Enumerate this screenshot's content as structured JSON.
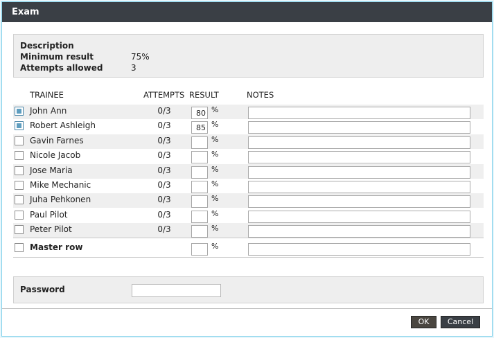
{
  "window": {
    "title": "Exam"
  },
  "info": {
    "description_label": "Description",
    "description_value": "",
    "min_result_label": "Minimum result",
    "min_result_value": "75%",
    "attempts_label": "Attempts allowed",
    "attempts_value": "3"
  },
  "table": {
    "headers": {
      "trainee": "TRAINEE",
      "attempts": "ATTEMPTS",
      "result": "RESULT",
      "notes": "NOTES"
    },
    "percent_sign": "%",
    "rows": [
      {
        "name": "John Ann",
        "attempts": "0/3",
        "result": "80",
        "checked": true
      },
      {
        "name": "Robert Ashleigh",
        "attempts": "0/3",
        "result": "85",
        "checked": true
      },
      {
        "name": "Gavin Farnes",
        "attempts": "0/3",
        "result": "",
        "checked": false
      },
      {
        "name": "Nicole Jacob",
        "attempts": "0/3",
        "result": "",
        "checked": false
      },
      {
        "name": "Jose Maria",
        "attempts": "0/3",
        "result": "",
        "checked": false
      },
      {
        "name": "Mike Mechanic",
        "attempts": "0/3",
        "result": "",
        "checked": false
      },
      {
        "name": "Juha Pehkonen",
        "attempts": "0/3",
        "result": "",
        "checked": false
      },
      {
        "name": "Paul Pilot",
        "attempts": "0/3",
        "result": "",
        "checked": false
      },
      {
        "name": "Peter Pilot",
        "attempts": "0/3",
        "result": "",
        "checked": false
      }
    ],
    "master_row": {
      "label": "Master row",
      "result": ""
    }
  },
  "password": {
    "label": "Password",
    "value": ""
  },
  "buttons": {
    "ok": "OK",
    "cancel": "Cancel"
  },
  "colors": {
    "titlebar": "#3a3f45",
    "checkbox_checked": "#5f9ec0",
    "border_accent": "#7fd0ea"
  }
}
